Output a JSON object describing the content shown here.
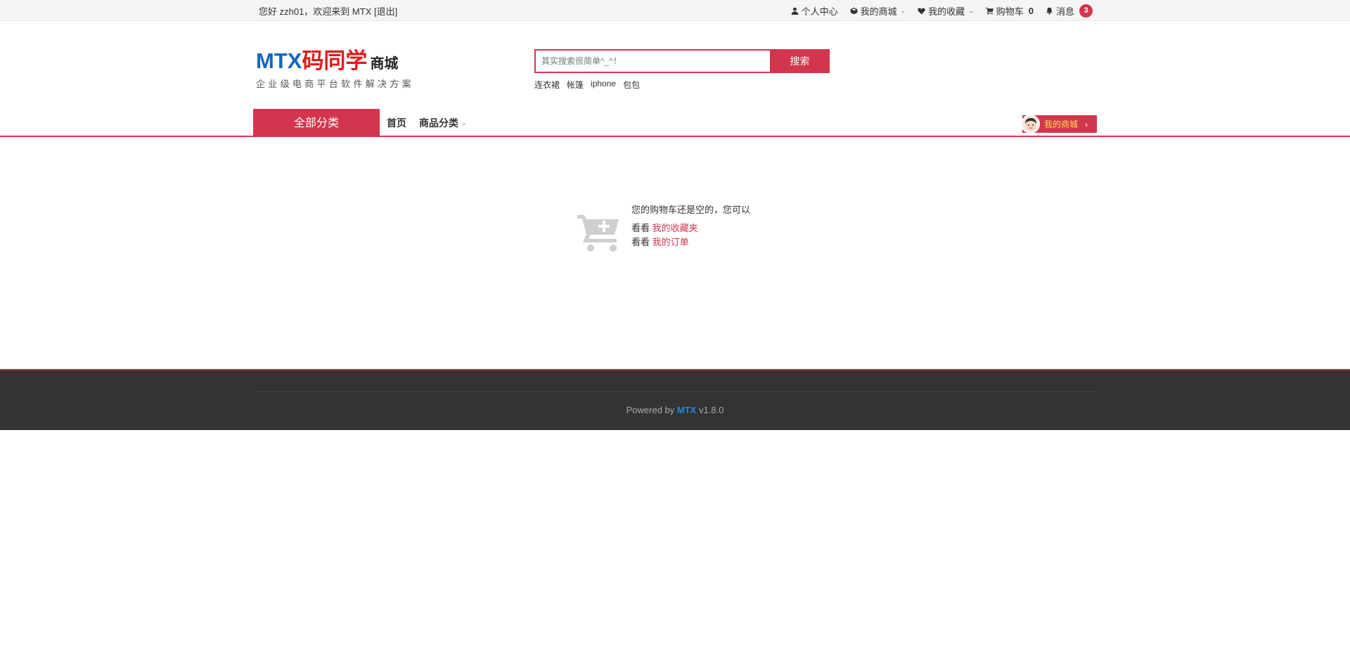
{
  "topbar": {
    "greeting": "您好 zzh01，欢迎来到 MTX ",
    "logout": "[退出]",
    "links": {
      "user_center": "个人中心",
      "my_shop": "我的商城",
      "favorites": "我的收藏",
      "cart": "购物车",
      "cart_count": "0",
      "messages": "消息",
      "message_count": "3"
    }
  },
  "logo": {
    "mtx": "MTX",
    "cn": "码同学",
    "shop": "商城",
    "slogan": "企业级电商平台软件解决方案"
  },
  "search": {
    "placeholder": "其实搜索很简单^_^！",
    "button": "搜索",
    "hot_words": [
      "连衣裙",
      "帐篷",
      "iphone",
      "包包"
    ]
  },
  "nav": {
    "all_categories": "全部分类",
    "home": "首页",
    "categories": "商品分类",
    "my_shop": "我的商城"
  },
  "empty_cart": {
    "title": "您的购物车还是空的，您可以",
    "prefix": "看看",
    "favorites_link": "我的收藏夹",
    "orders_link": "我的订单"
  },
  "footer": {
    "powered_by": "Powered by ",
    "brand": "MTX",
    "version": " v1.8.0"
  },
  "colors": {
    "accent": "#d2364c",
    "brand_blue": "#1565c0",
    "footer_bg": "#333333"
  }
}
